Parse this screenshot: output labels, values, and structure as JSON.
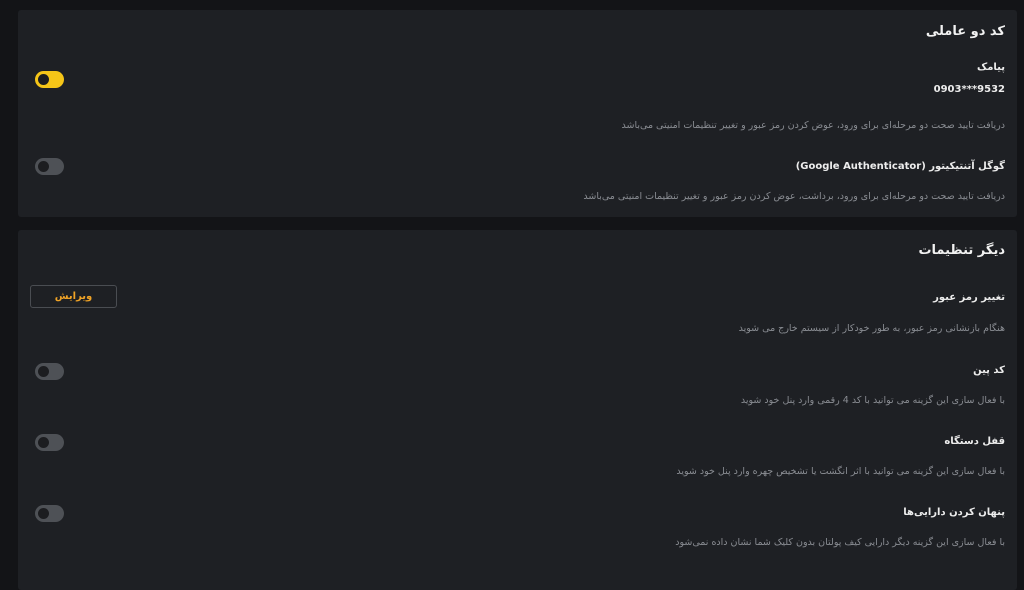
{
  "two_factor": {
    "title": "کد دو عاملی",
    "sms": {
      "label": "پیامک",
      "phone": "0903***9532",
      "description": "دریافت تایید صحت دو مرحله‌ای برای ورود، عوض کردن رمز عبور و تغییر تنظیمات امنیتی می‌باشد",
      "enabled": true
    },
    "google_auth": {
      "label": "گوگل آتنتیکیتور (Google Authenticator)",
      "description": "دریافت تایید صحت دو مرحله‌ای برای ورود، برداشت، عوض کردن رمز عبور و تغییر تنظیمات امنیتی می‌باشد",
      "enabled": false
    }
  },
  "other_settings": {
    "title": "دیگر تنظیمات",
    "change_password": {
      "label": "تغییر رمز عبور",
      "description": "هنگام بازنشانی رمز عبور، به طور خودکار از سیستم خارج می شوید",
      "button_label": "ویرایش"
    },
    "pin_code": {
      "label": "کد پین",
      "description": "با فعال سازی این گزینه می توانید با کد 4 رقمی وارد پنل خود شوید",
      "enabled": false
    },
    "device_lock": {
      "label": "قفل دستگاه",
      "description": "با فعال سازی این گزینه می توانید با اثر انگشت یا تشخیص چهره وارد پنل خود شوید",
      "enabled": false
    },
    "hide_assets": {
      "label": "پنهان کردن دارایی‌ها",
      "description": "با فعال سازی این گزینه دیگر دارایی کیف پولتان بدون کلیک شما نشان داده نمی‌شود",
      "enabled": false
    }
  },
  "colors": {
    "accent": "#f5c518",
    "edit_text": "#f0a326",
    "card_bg": "#1e2024",
    "page_bg": "#131417"
  }
}
